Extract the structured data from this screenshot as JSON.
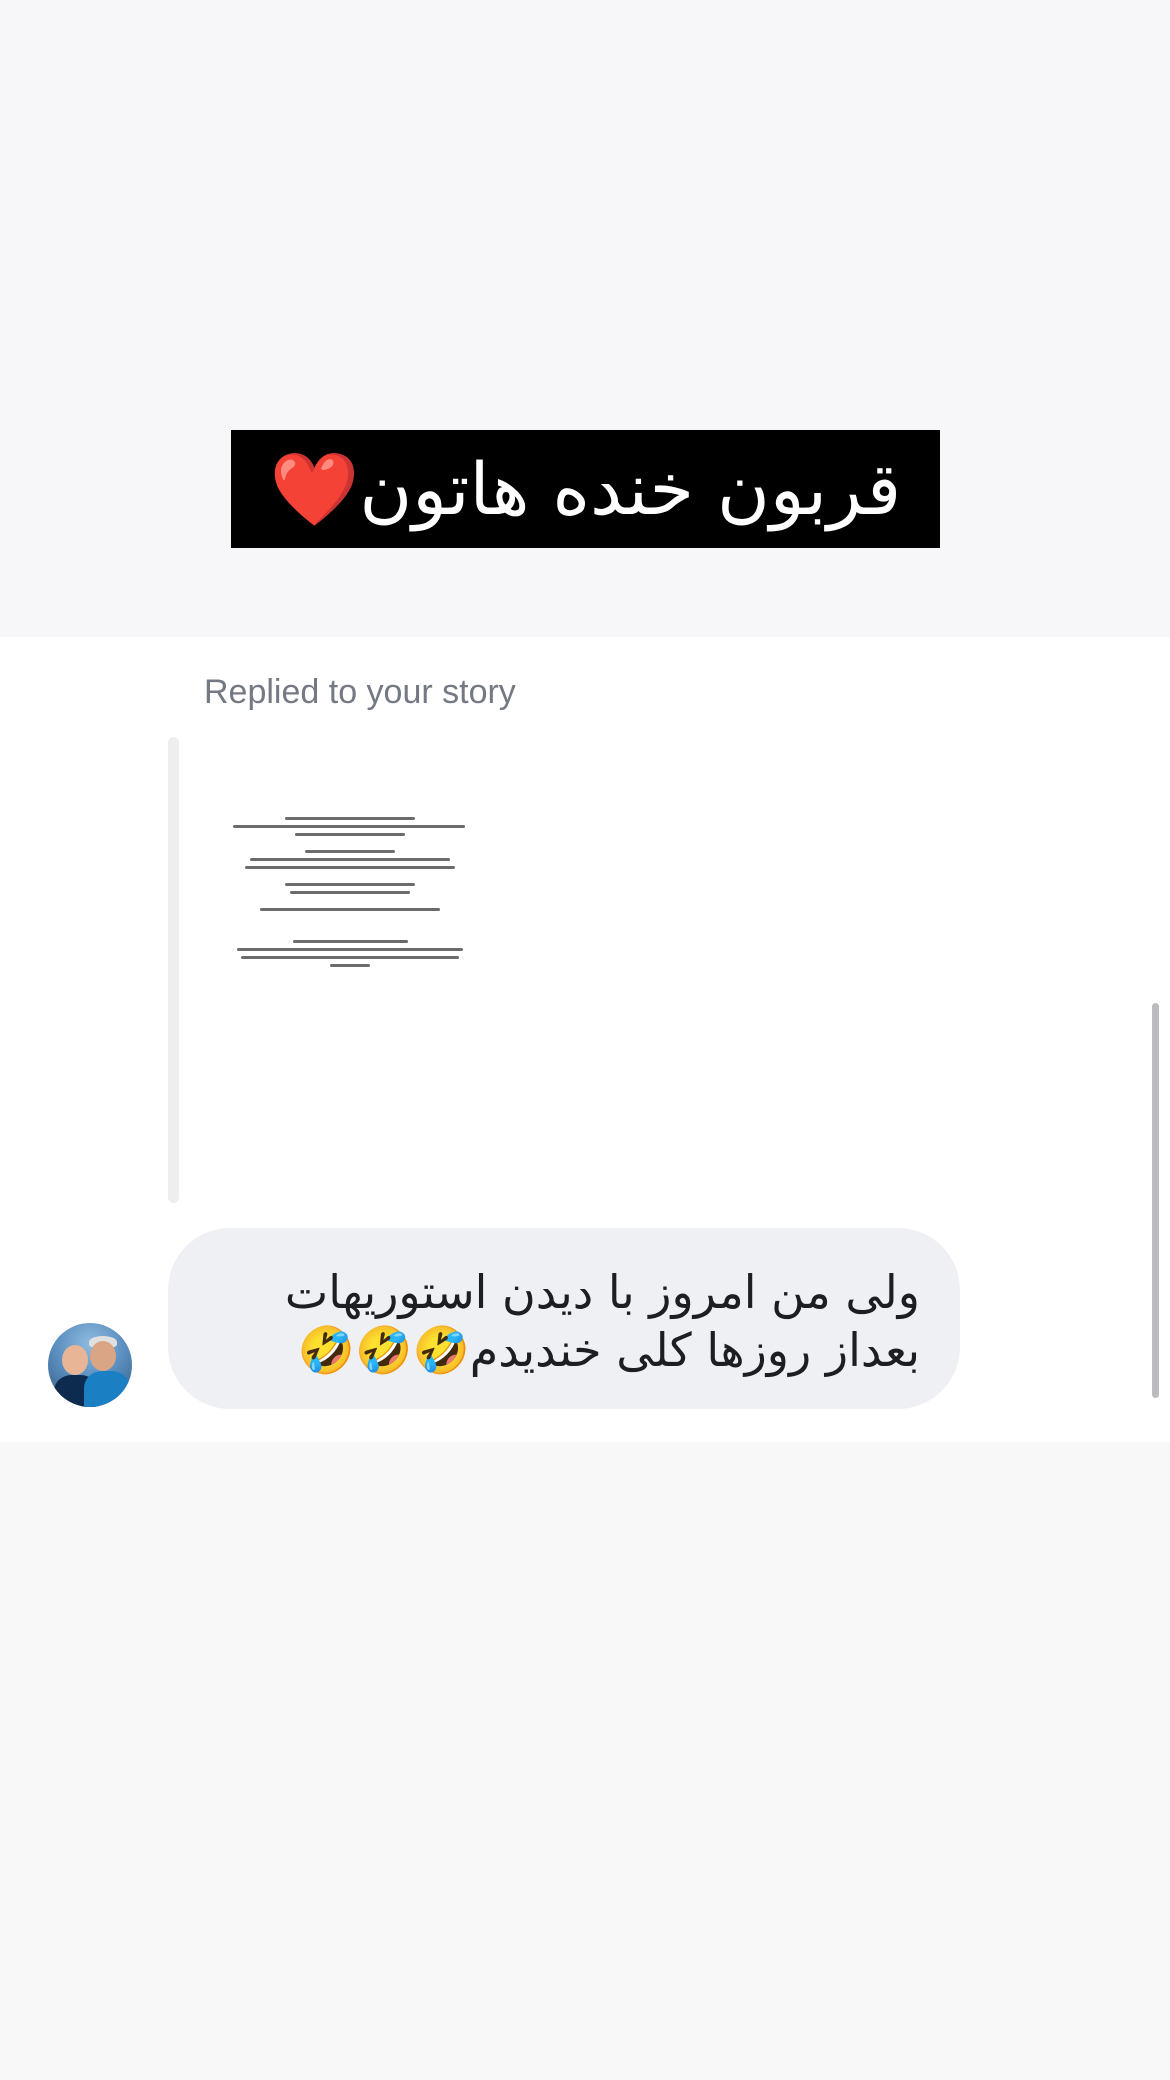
{
  "story": {
    "caption": "قربون خنده هاتون❤️"
  },
  "conversation": {
    "replied_label": "Replied to your story",
    "message": {
      "text": "ولی من امروز با دیدن استوریهات بعداز روزها کلی خندیدم🤣🤣🤣"
    }
  }
}
